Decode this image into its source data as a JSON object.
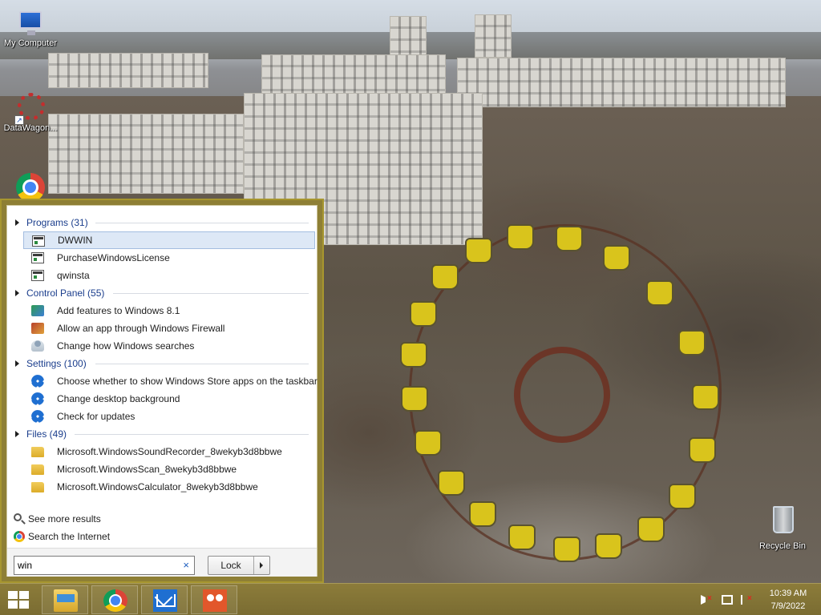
{
  "desktop": {
    "icons": [
      {
        "label": "My Computer",
        "icon": "computer-icon"
      },
      {
        "label": "DataWagon...",
        "icon": "datawagon-icon"
      },
      {
        "label": "",
        "icon": "chrome-icon"
      },
      {
        "label": "Recycle Bin",
        "icon": "recycle-bin-icon"
      }
    ]
  },
  "start_menu": {
    "groups": [
      {
        "title": "Programs (31)",
        "items": [
          "DWWIN",
          "PurchaseWindowsLicense",
          "qwinsta"
        ],
        "selected_index": 0,
        "icon": "program-icon"
      },
      {
        "title": "Control Panel (55)",
        "items": [
          "Add features to Windows 8.1",
          "Allow an app through Windows Firewall",
          "Change how Windows searches"
        ],
        "icons": [
          "control-panel-icon",
          "firewall-icon",
          "user-search-icon"
        ]
      },
      {
        "title": "Settings (100)",
        "items": [
          "Choose whether to show Windows Store apps on the taskbar",
          "Change desktop background",
          "Check for updates"
        ],
        "icon": "gear-icon"
      },
      {
        "title": "Files (49)",
        "items": [
          "Microsoft.WindowsSoundRecorder_8wekyb3d8bbwe",
          "Microsoft.WindowsScan_8wekyb3d8bbwe",
          "Microsoft.WindowsCalculator_8wekyb3d8bbwe"
        ],
        "icon": "folder-icon"
      }
    ],
    "see_more": "See more results",
    "search_internet": "Search the Internet",
    "search": {
      "value": "win",
      "clear": "×"
    },
    "power_button": "Lock"
  },
  "taskbar": {
    "pinned": [
      "file-explorer-icon",
      "chrome-icon",
      "mail-icon",
      "people-icon"
    ],
    "clock": {
      "time": "10:39 AM",
      "date": "7/9/2022"
    },
    "tray": [
      "speaker-muted-icon",
      "network-icon",
      "action-center-flag-icon"
    ]
  }
}
